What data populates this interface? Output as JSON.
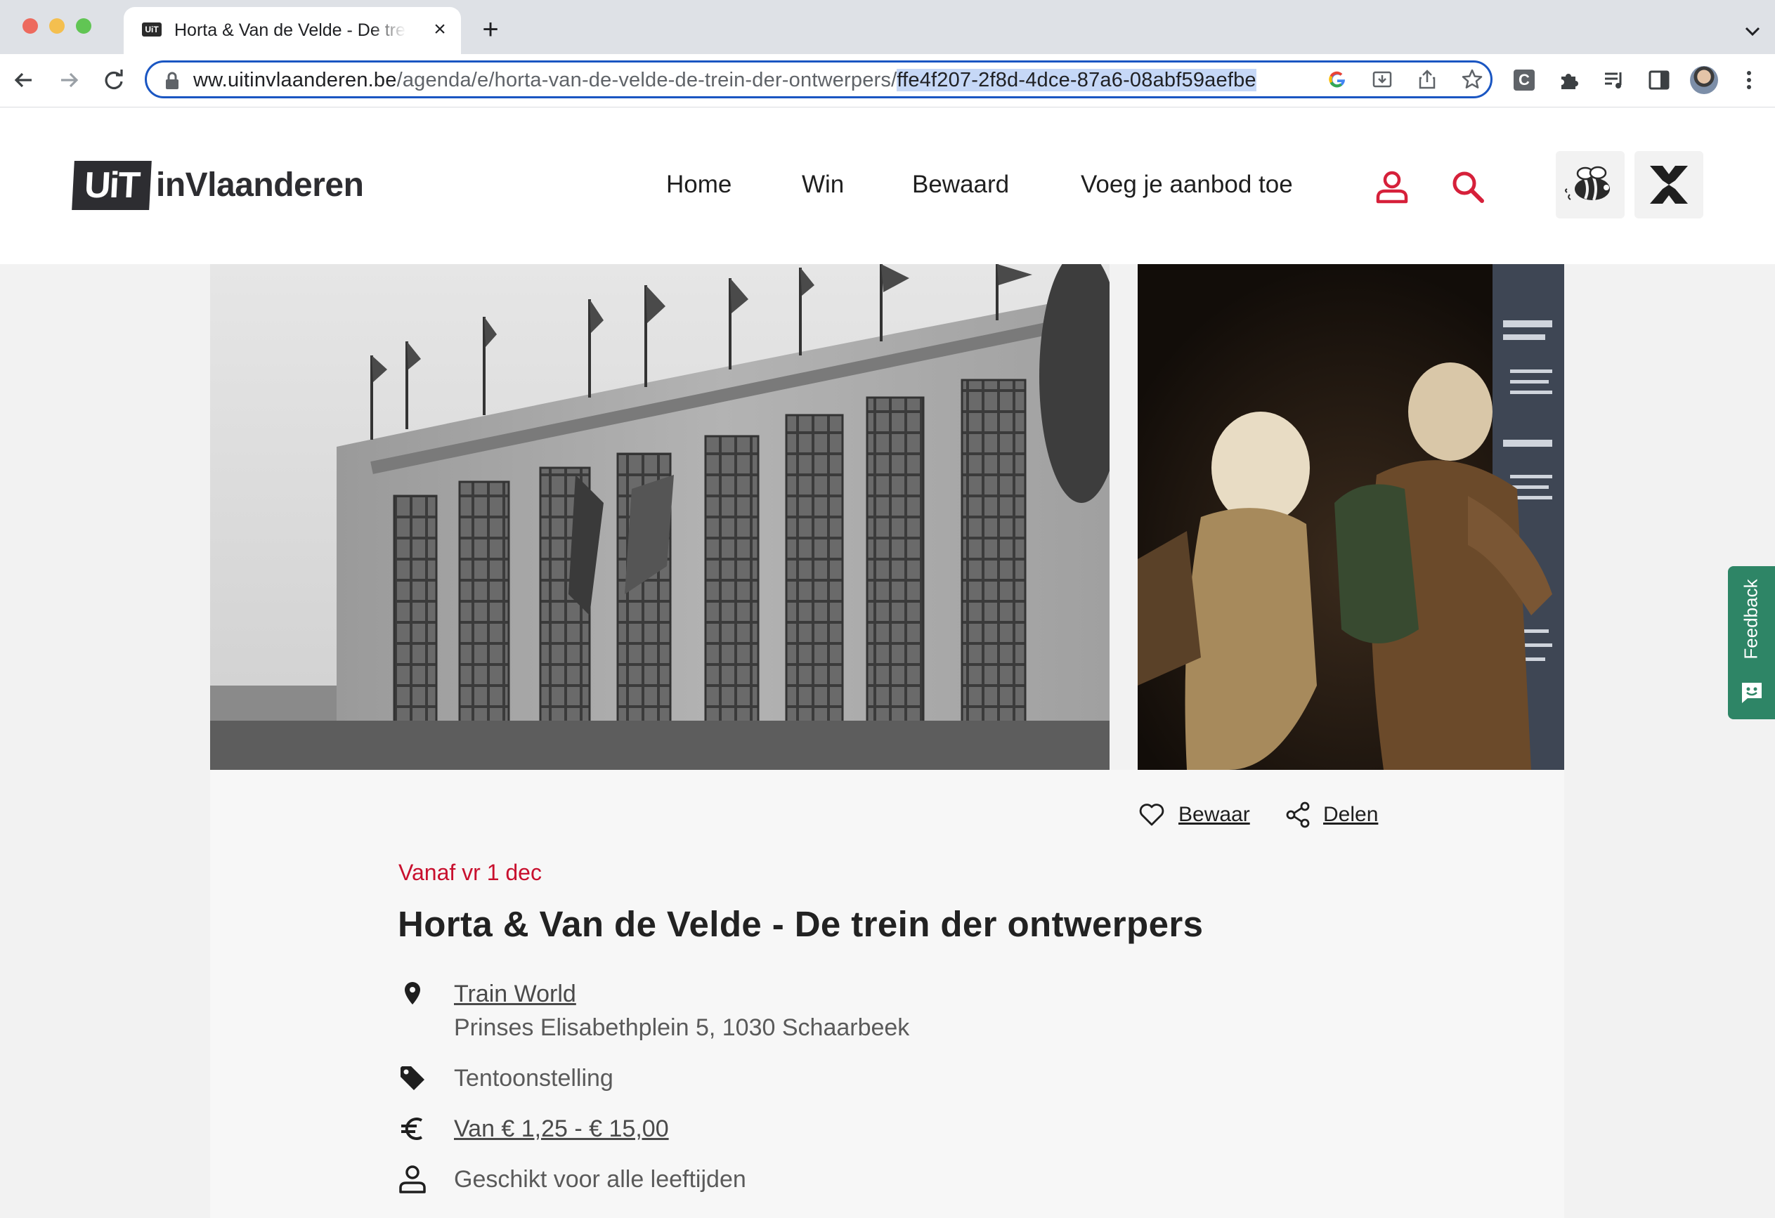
{
  "browser": {
    "tab_title": "Horta & Van de Velde - De trein der ontwerpers",
    "url_visible": "ww.uitinvlaanderen.be",
    "url_path": "/agenda/e/horta-van-de-velde-de-trein-der-ontwerpers/",
    "url_selected": "ffe4f207-2f8d-4dce-87a6-08abf59aefbe",
    "colors": {
      "omnibox_border": "#1a56c2",
      "selection": "#c6d8f7"
    }
  },
  "site": {
    "logo_box": "UiT",
    "logo_text": "inVlaanderen",
    "nav": [
      "Home",
      "Win",
      "Bewaard",
      "Voeg je aanbod toe"
    ],
    "accent_color": "#d6203a"
  },
  "event": {
    "save_label": "Bewaar",
    "share_label": "Delen",
    "date_text": "Vanaf vr 1 dec",
    "title": "Horta & Van de Velde - De trein der ontwerpers",
    "location_name": "Train World",
    "address": "Prinses Elisabethplein 5, 1030 Schaarbeek",
    "category": "Tentoonstelling",
    "price": "Van € 1,25 - € 15,00",
    "age": "Geschikt voor alle leeftijden",
    "date_color": "#c8102e"
  },
  "feedback": {
    "label": "Feedback",
    "color": "#2e8566"
  },
  "icons": [
    "back-arrow-icon",
    "forward-arrow-icon",
    "reload-icon",
    "lock-icon",
    "google-icon",
    "install-icon",
    "share-icon",
    "star-icon",
    "extension-c-icon",
    "puzzle-icon",
    "media-icon",
    "sidepanel-icon",
    "user-icon",
    "search-icon",
    "bee-icon",
    "close-x-icon",
    "heart-icon",
    "share-nodes-icon",
    "location-pin-icon",
    "tag-icon",
    "euro-icon",
    "person-icon",
    "feedback-smiley-icon"
  ]
}
